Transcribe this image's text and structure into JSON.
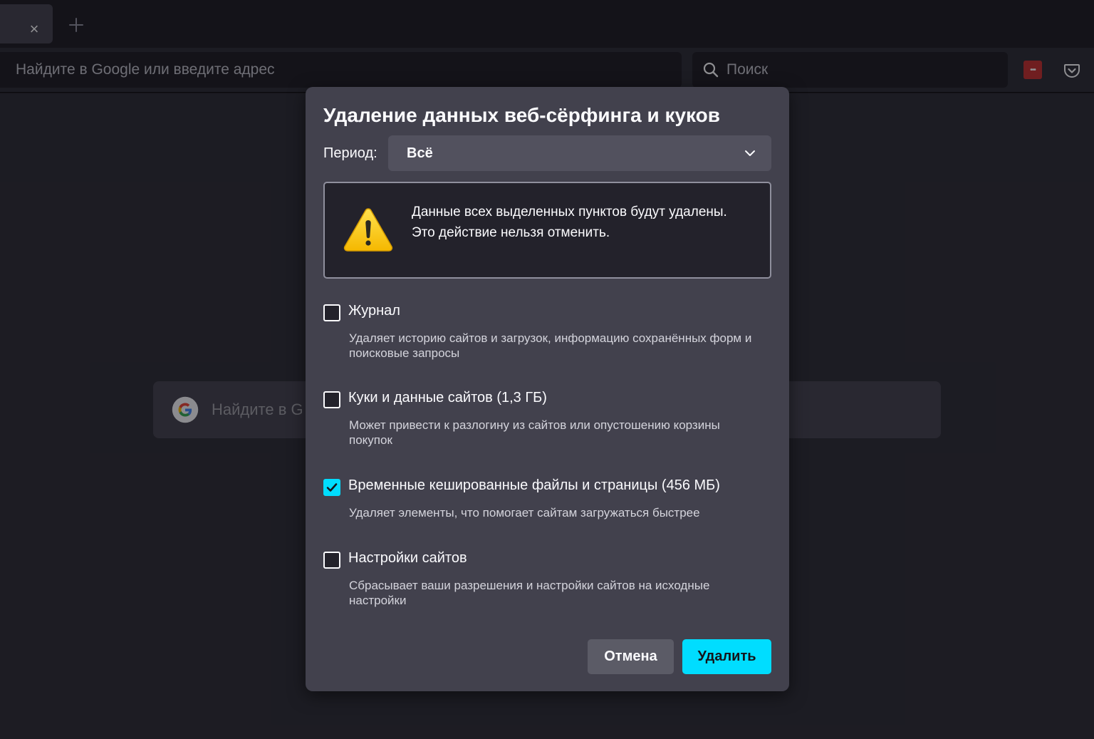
{
  "tabs": {
    "close_symbol": "×",
    "new_tab_symbol": "+"
  },
  "navbar": {
    "url_placeholder": "Найдите в Google или введите адрес",
    "search_placeholder": "Поиск",
    "extension_symbol": "•••"
  },
  "page": {
    "search_placeholder": "Найдите в G"
  },
  "dialog": {
    "title": "Удаление данных веб-сёрфинга и куков",
    "period_label": "Период:",
    "period_value": "Всё",
    "warning": {
      "line1": "Данные всех выделенных пунктов будут удалены.",
      "line2": "Это действие нельзя отменить."
    },
    "options": [
      {
        "label": "Журнал",
        "description": "Удаляет историю сайтов и загрузок, информацию сохранённых форм и поисковые запросы",
        "checked": false
      },
      {
        "label": "Куки и данные сайтов (1,3 ГБ)",
        "description": "Может привести к разлогину из сайтов или опустошению корзины покупок",
        "checked": false
      },
      {
        "label": "Временные кешированные файлы и страницы (456 МБ)",
        "description": "Удаляет элементы, что помогает сайтам загружаться быстрее",
        "checked": true
      },
      {
        "label": "Настройки сайтов",
        "description": "Сбрасывает ваши разрешения и настройки сайтов на исходные настройки",
        "checked": false
      }
    ],
    "cancel_label": "Отмена",
    "delete_label": "Удалить"
  },
  "colors": {
    "accent": "#00ddff",
    "dialog_bg": "#42414d",
    "warning_bg": "#23222b"
  }
}
